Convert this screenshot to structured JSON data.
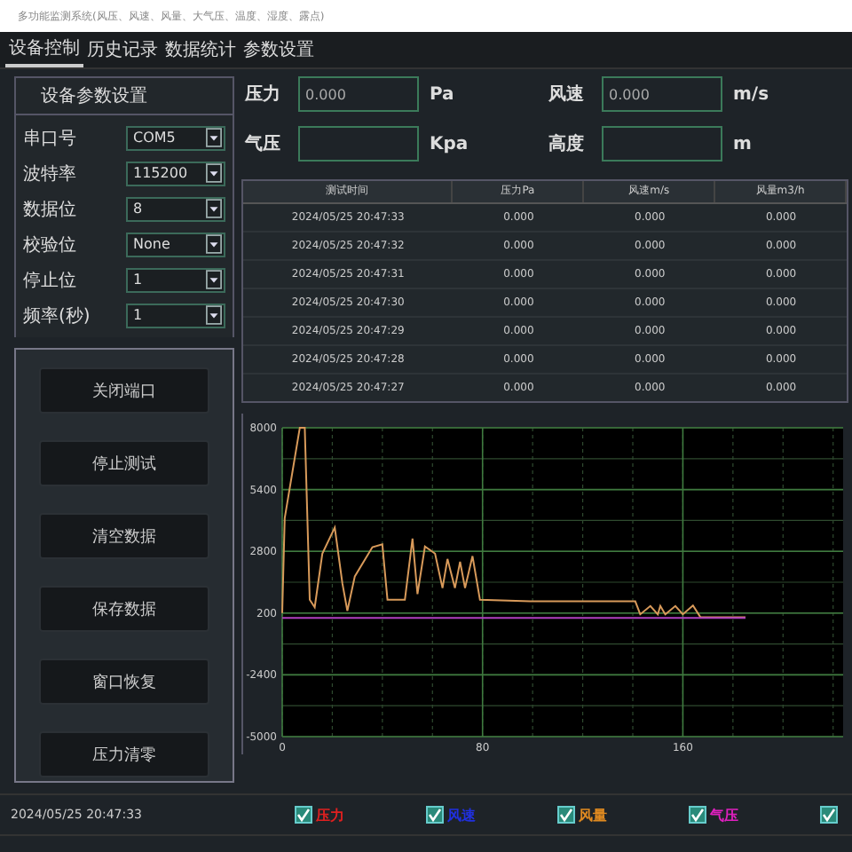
{
  "window": {
    "title": "多功能监测系统(风压、风速、风量、大气压、温度、湿度、露点)"
  },
  "tabs": [
    {
      "label": "设备控制",
      "selected": true
    },
    {
      "label": "历史记录",
      "selected": false
    },
    {
      "label": "数据统计",
      "selected": false
    },
    {
      "label": "参数设置",
      "selected": false
    }
  ],
  "settings": {
    "title": "设备参数设置",
    "rows": [
      {
        "label": "串口号",
        "value": "COM5"
      },
      {
        "label": "波特率",
        "value": "115200"
      },
      {
        "label": "数据位",
        "value": "8"
      },
      {
        "label": "校验位",
        "value": "None"
      },
      {
        "label": "停止位",
        "value": "1"
      },
      {
        "label": "频率(秒)",
        "value": "1"
      }
    ]
  },
  "buttons": [
    "关闭端口",
    "停止测试",
    "清空数据",
    "保存数据",
    "窗口恢复",
    "压力清零"
  ],
  "fields": [
    {
      "label": "压力",
      "value": "0.000",
      "unit": "Pa"
    },
    {
      "label": "风速",
      "value": "0.000",
      "unit": "m/s"
    },
    {
      "label": "气压",
      "unit": "Kpa"
    },
    {
      "label": "高度",
      "unit": "m"
    }
  ],
  "table": {
    "columns": [
      "测试时间",
      "压力Pa",
      "风速m/s",
      "风量m3/h"
    ],
    "rows": [
      [
        "2024/05/25 20:47:33",
        "0.000",
        "0.000",
        "0.000"
      ],
      [
        "2024/05/25 20:47:32",
        "0.000",
        "0.000",
        "0.000"
      ],
      [
        "2024/05/25 20:47:31",
        "0.000",
        "0.000",
        "0.000"
      ],
      [
        "2024/05/25 20:47:30",
        "0.000",
        "0.000",
        "0.000"
      ],
      [
        "2024/05/25 20:47:29",
        "0.000",
        "0.000",
        "0.000"
      ],
      [
        "2024/05/25 20:47:28",
        "0.000",
        "0.000",
        "0.000"
      ],
      [
        "2024/05/25 20:47:27",
        "0.000",
        "0.000",
        "0.000"
      ]
    ]
  },
  "chart": {
    "chart_data": {
      "type": "line",
      "grid": true,
      "xlim": [
        0,
        224
      ],
      "ylim": [
        -5000,
        8000
      ],
      "xticks": [
        0,
        80,
        160
      ],
      "yticks": [
        8000,
        5400,
        2800,
        200,
        -2400,
        -5000
      ],
      "series": [
        {
          "color": "#d89a5a",
          "x": [
            0,
            1,
            7,
            9,
            11,
            13,
            16,
            21,
            24,
            26,
            29,
            36,
            40,
            42,
            49,
            52,
            54,
            57,
            61,
            64,
            66,
            69,
            71,
            73,
            76,
            79,
            99,
            141,
            143,
            147,
            150,
            151,
            153,
            157,
            160,
            164,
            167,
            185
          ],
          "values": [
            200,
            4200,
            8000,
            8000,
            760,
            450,
            2700,
            3800,
            1450,
            300,
            1750,
            2970,
            3090,
            760,
            760,
            3340,
            1000,
            3000,
            2700,
            1250,
            2480,
            1250,
            2360,
            1250,
            2600,
            760,
            690,
            690,
            150,
            500,
            150,
            500,
            150,
            500,
            150,
            520,
            30,
            30
          ]
        },
        {
          "color": "#b040c0",
          "x": [
            0,
            185
          ],
          "values": [
            0,
            0
          ]
        }
      ]
    }
  },
  "status": {
    "time": "2024/05/25 20:47:33"
  },
  "legend": [
    {
      "label": "压力",
      "color": "#e02020",
      "checked": true
    },
    {
      "label": "风速",
      "color": "#2030e0",
      "checked": true
    },
    {
      "label": "风量",
      "color": "#e08a20",
      "checked": true
    },
    {
      "label": "气压",
      "color": "#e020c0",
      "checked": true
    },
    {
      "checked": true
    }
  ]
}
